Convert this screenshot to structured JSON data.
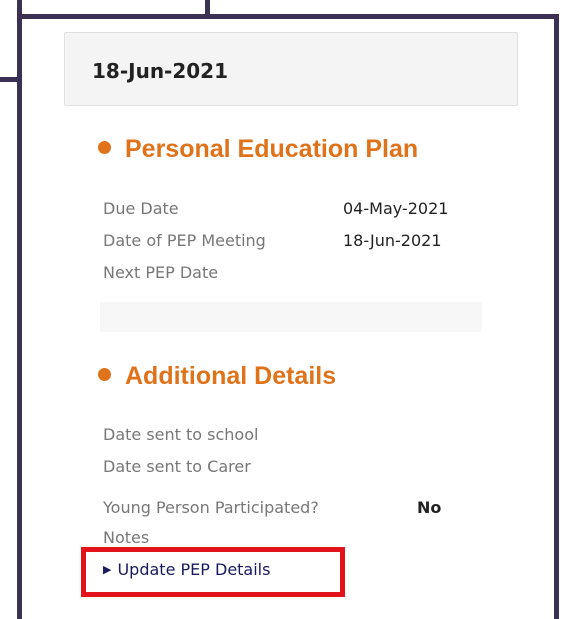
{
  "header": {
    "date": "18-Jun-2021"
  },
  "pep_section": {
    "title": "Personal Education Plan",
    "rows": [
      {
        "label": "Due Date",
        "value": "04-May-2021"
      },
      {
        "label": "Date of PEP Meeting",
        "value": "18-Jun-2021"
      },
      {
        "label": "Next PEP Date",
        "value": ""
      }
    ]
  },
  "additional_section": {
    "title": "Additional Details",
    "rows": [
      {
        "label": "Date sent to school",
        "value": ""
      },
      {
        "label": "Date sent to Carer",
        "value": ""
      },
      {
        "label": "Young Person Participated?",
        "value": "No"
      },
      {
        "label": "Notes",
        "value": ""
      }
    ]
  },
  "actions": {
    "update_label": "Update PEP Details"
  },
  "colors": {
    "accent": "#e0731a",
    "highlight": "#e3131b",
    "frame": "#3b3152",
    "link": "#1a1a5e"
  },
  "icons": {
    "section_bullet": "filled-circle",
    "link_arrow": "right-triangle"
  }
}
